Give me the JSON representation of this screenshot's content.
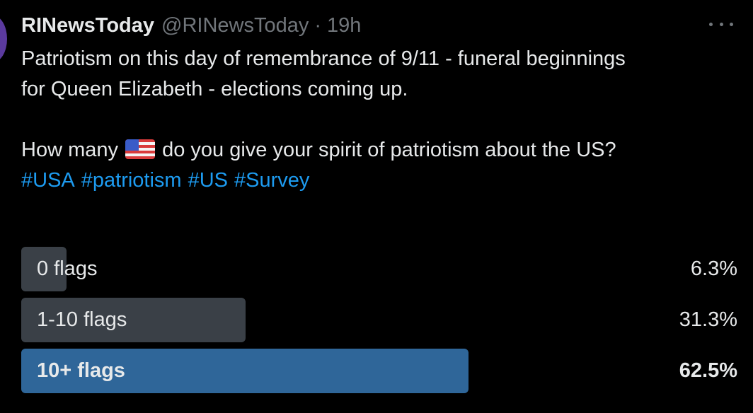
{
  "tweet": {
    "display_name": "RINewsToday",
    "handle": "@RINewsToday",
    "separator": "·",
    "time": "19h",
    "text_line1": "Patriotism on this day of remembrance of 9/11 - funeral beginnings",
    "text_line2": "for Queen Elizabeth - elections coming up.",
    "question_before": "How many ",
    "question_after": " do you give your spirit of patriotism about the US?",
    "question_icon": "us-flag-emoji",
    "hashtags": [
      "#USA",
      "#patriotism",
      "#US",
      "#Survey"
    ]
  },
  "poll": {
    "options": [
      {
        "label": "0 flags",
        "percent_text": "6.3%",
        "percent": 6.3
      },
      {
        "label": "1-10 flags",
        "percent_text": "31.3%",
        "percent": 31.3
      },
      {
        "label": "10+ flags",
        "percent_text": "62.5%",
        "percent": 62.5
      }
    ],
    "winner_index": 2
  },
  "colors": {
    "background": "#000000",
    "text": "#e7e9ea",
    "muted": "#71767b",
    "link": "#1d9bf0",
    "bar": "#3a4047",
    "winner_bar": "#2f6699"
  }
}
